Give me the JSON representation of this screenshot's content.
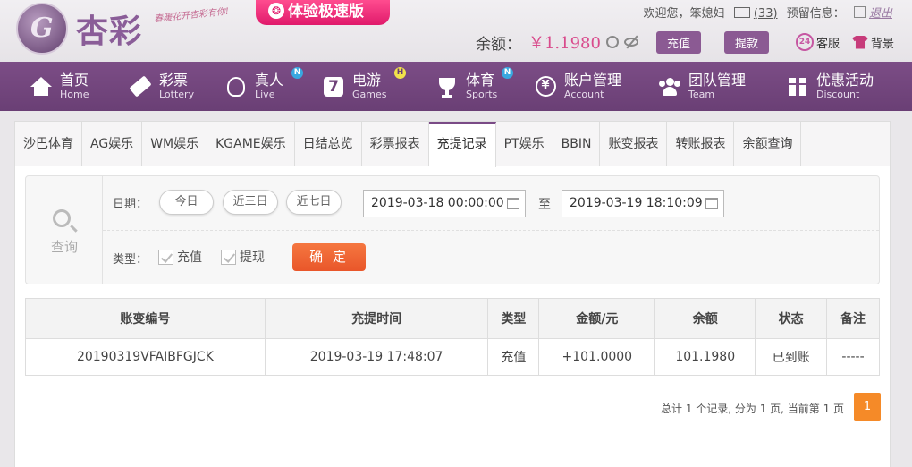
{
  "brand": {
    "logo_text": "杏彩",
    "slogan": "春暖花开杏彩有你!",
    "logo_glyph": "G"
  },
  "promo": {
    "label": "体验极速版"
  },
  "top_bar": {
    "welcome": "欢迎您，",
    "username": "笨媳妇",
    "message_count": "(33)",
    "alerts_label": "预留信息：",
    "logout_label": "退出"
  },
  "balance": {
    "label": "余额：",
    "value": "￥1.1980",
    "deposit_label": "充值",
    "withdraw_label": "提款",
    "service_label": "客服",
    "service_badge": "24",
    "background_label": "背景"
  },
  "nav": {
    "items": [
      {
        "zh": "首页",
        "en": "Home"
      },
      {
        "zh": "彩票",
        "en": "Lottery"
      },
      {
        "zh": "真人",
        "en": "Live",
        "badge": "N"
      },
      {
        "zh": "电游",
        "en": "Games",
        "badge": "H"
      },
      {
        "zh": "体育",
        "en": "Sports",
        "badge": "N"
      },
      {
        "zh": "账户管理",
        "en": "Account"
      },
      {
        "zh": "团队管理",
        "en": "Team"
      },
      {
        "zh": "优惠活动",
        "en": "Discount"
      }
    ],
    "seven_glyph": "7",
    "yen_glyph": "¥"
  },
  "tabs": [
    "沙巴体育",
    "AG娱乐",
    "WM娱乐",
    "KGAME娱乐",
    "日结总览",
    "彩票报表",
    "充提记录",
    "PT娱乐",
    "BBIN",
    "账变报表",
    "转账报表",
    "余额查询"
  ],
  "active_tab_index": 6,
  "filter": {
    "query_label": "查询",
    "date_label": "日期：",
    "quick_ranges": [
      "今日",
      "近三日",
      "近七日"
    ],
    "start_date": "2019-03-18 00:00:00",
    "to_label": "至",
    "end_date": "2019-03-19 18:10:09",
    "type_label": "类型：",
    "types": [
      "充值",
      "提现"
    ],
    "confirm_label": "确 定"
  },
  "table": {
    "headers": [
      "账变编号",
      "充提时间",
      "类型",
      "金额/元",
      "余额",
      "状态",
      "备注"
    ],
    "rows": [
      [
        "20190319VFAIBFGJCK",
        "2019-03-19 17:48:07",
        "充值",
        "+101.0000",
        "101.1980",
        "已到账",
        "-----"
      ]
    ]
  },
  "pager": {
    "summary": "总计 1 个记录, 分为 1 页, 当前第 1 页",
    "current_page": "1"
  },
  "colors": {
    "nav_bg": "#7c4d86",
    "accent_pink": "#d94b8c",
    "confirm_orange": "#e9562a",
    "page_orange": "#f58a28",
    "amount_red": "#d0021b",
    "status_green": "#2b8f1b"
  }
}
